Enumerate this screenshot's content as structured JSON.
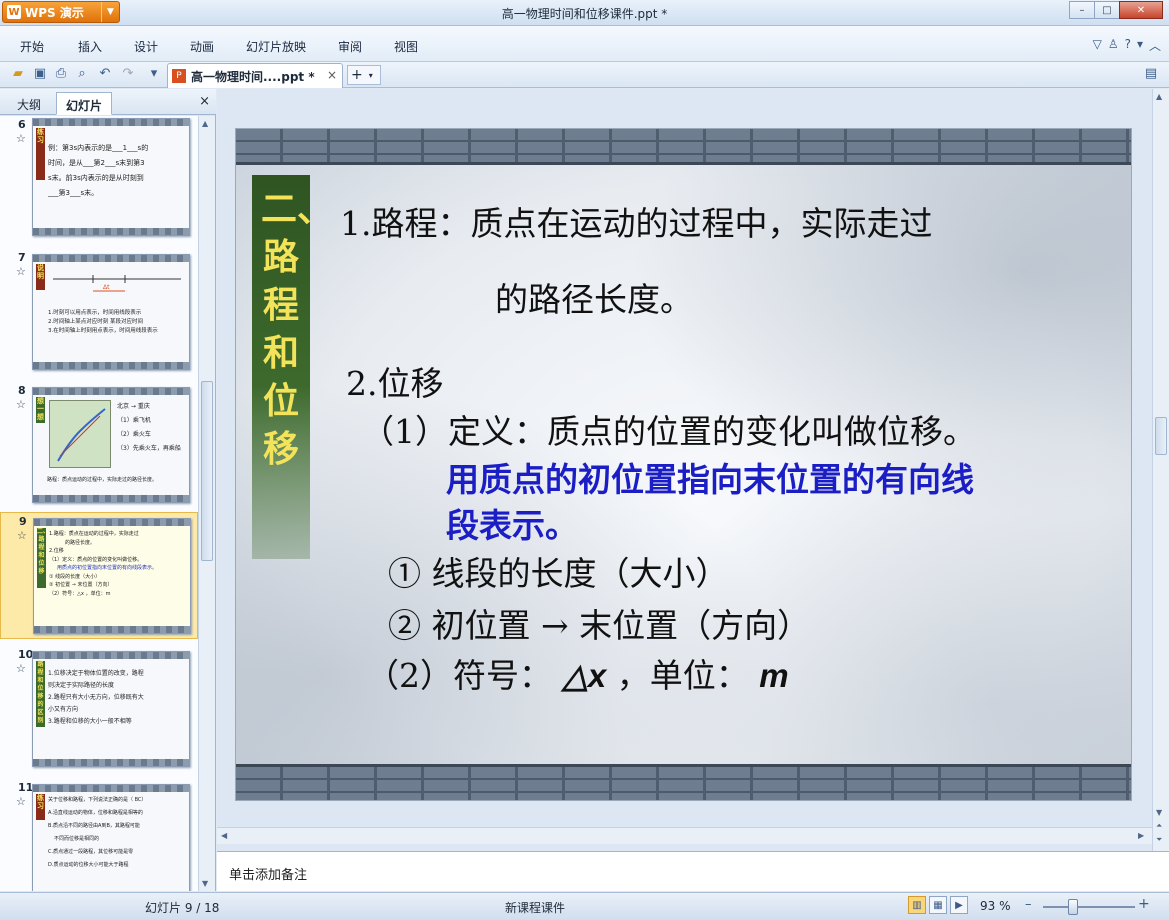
{
  "app": {
    "name": "WPS 演示",
    "logo": "W",
    "document_title": "高一物理时间和位移课件.ppt *"
  },
  "window_controls": {
    "minimize": "–",
    "maximize": "□",
    "close": "✕"
  },
  "menu": {
    "items": [
      "开始",
      "插入",
      "设计",
      "动画",
      "幻灯片放映",
      "审阅",
      "视图"
    ],
    "right_icons": [
      "tshirt-icon",
      "help-icon"
    ],
    "help": "?"
  },
  "toolbar": {
    "icons": [
      "open-folder-icon",
      "save-icon",
      "print-icon",
      "print-preview-icon",
      "undo-icon",
      "redo-icon",
      "customize-icon"
    ],
    "doc_tab_label": "高一物理时间....ppt *",
    "doc_tab_close": "×",
    "new_tab": "+",
    "new_tab_dropdown": "▾"
  },
  "left_panel": {
    "tabs": [
      "大纲",
      "幻灯片"
    ],
    "active_tab": "幻灯片",
    "close": "×",
    "thumbnails": [
      {
        "num": "6",
        "label": "练习",
        "lines": [
          "例：第3s内表示的是___1___s的",
          "时间，是从___第2___s末到第3",
          "s末。前3s内表示的是从时刻到",
          "___第3___s末。"
        ]
      },
      {
        "num": "7",
        "label": "说明",
        "lines": [
          "1.时刻可以用点表示，时间用线段表示",
          "2.时间轴上某点对应时刻 某段对应时间",
          "3.在时间轴上时刻用点表示，时间用线段表示"
        ]
      },
      {
        "num": "8",
        "label": "想一想",
        "lines": [
          "北京 → 重庆",
          "（1）乘飞机",
          "（2）乘火车",
          "（3）先乘火车，再乘船",
          "路程：质点运动的过程中，实际走过的路径长度。"
        ]
      },
      {
        "num": "9",
        "label": "二、路程和位移",
        "lines": [
          "1.路程：质点在运动的过程中，实际走过",
          "的路径长度。",
          "2.位移",
          "（1）定义：质点的位置的变化叫做位移。",
          "用质点的初位置指向末位置的有向线段表示。",
          "① 线段的长度（大小）",
          "② 初位置 → 末位置（方向）",
          "（2）符号：△x ，单位：m"
        ]
      },
      {
        "num": "10",
        "label": "路程和位移的区别",
        "lines": [
          "1.位移决定于物体位置的改变，路程",
          "则决定于实际路径的长度",
          "2.路程只有大小无方向，位移既有大",
          "小又有方向",
          "3.路程和位移的大小一般不相等"
        ]
      },
      {
        "num": "11",
        "label": "练习",
        "lines": [
          "关于位移和路程，下列说法正确的是（ BC）",
          "A.沿直线运动的物体，位移和路程是相等的",
          "B.质点沿不同的路径由A到B，其路程可能",
          "不同而位移是相同的",
          "C.质点通过一段路程，其位移可能是零",
          "D.质点运动的位移大小可能大于路程"
        ]
      }
    ]
  },
  "slide": {
    "vertical_label": "二、路程和位移",
    "lines": {
      "l1": "1.路程：质点在运动的过程中，实际走过",
      "l2": "的路径长度。",
      "l3": "2.位移",
      "l4": "（1）定义：质点的位置的变化叫做位移。",
      "l5": "用质点的初位置指向末位置的有向线",
      "l6": "段表示。",
      "l7": "① 线段的长度（大小）",
      "l8": "② 初位置 → 末位置（方向）",
      "l9_prefix": "（2）符号：",
      "l9_symbol": "△x",
      "l9_mid": " ，单位：",
      "l9_unit": "m"
    },
    "colors": {
      "highlight_text": "#1a1ec4",
      "label_bg": "#3d6a2c",
      "label_text": "#f3e35a"
    }
  },
  "notes_placeholder": "单击添加备注",
  "status": {
    "slide_indicator": "幻灯片 9 / 18",
    "theme": "新课程课件",
    "zoom": "93 %",
    "zoom_fraction": 0.33,
    "zoom_minus": "–",
    "zoom_plus": "+",
    "views": [
      "normal-view-icon",
      "slide-sorter-icon",
      "slideshow-icon"
    ]
  }
}
